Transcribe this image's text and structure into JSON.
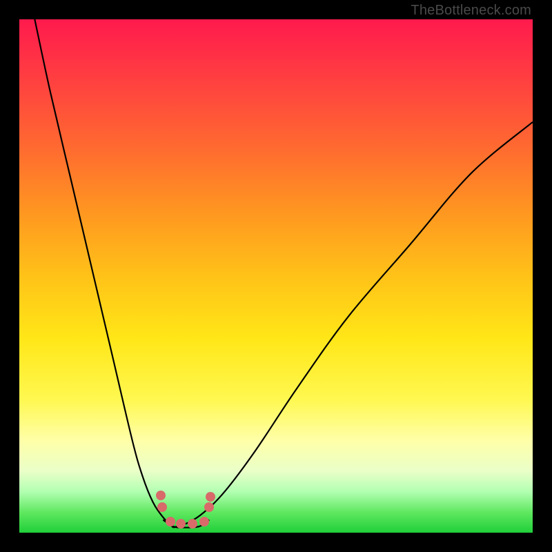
{
  "attribution": "TheBottleneck.com",
  "colors": {
    "dot": "#d86a6a",
    "curve": "#000000"
  },
  "chart_data": {
    "type": "line",
    "title": "",
    "xlabel": "",
    "ylabel": "",
    "xlim": [
      0,
      100
    ],
    "ylim": [
      0,
      100
    ],
    "grid": false,
    "series": [
      {
        "name": "curve-left",
        "x": [
          3,
          6,
          10,
          14,
          18,
          22,
          24,
          26,
          28,
          30
        ],
        "y": [
          100,
          86,
          69,
          52,
          35,
          18,
          11,
          6,
          3,
          1
        ]
      },
      {
        "name": "curve-right",
        "x": [
          30,
          33,
          36,
          40,
          46,
          54,
          64,
          76,
          88,
          100
        ],
        "y": [
          1,
          2,
          4,
          8,
          16,
          28,
          42,
          56,
          70,
          80
        ]
      },
      {
        "name": "bottom-arc",
        "x": [
          28,
          30,
          32,
          35,
          37
        ],
        "y": [
          2.5,
          1.2,
          1.0,
          1.2,
          2.5
        ]
      }
    ],
    "scatter": {
      "name": "highlight-dots",
      "x": [
        27.5,
        27.8,
        29.5,
        31.5,
        33.8,
        36.0,
        37.0,
        37.2
      ],
      "y": [
        7.2,
        5.0,
        2.2,
        1.8,
        1.8,
        2.2,
        5.0,
        7.0
      ]
    }
  }
}
